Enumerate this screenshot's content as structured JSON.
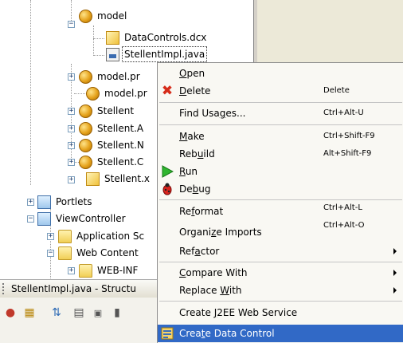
{
  "tree": {
    "nodes": [
      {
        "label": "model",
        "icon": "package-icon"
      },
      {
        "label": "DataControls.dcx",
        "icon": "dcx-file-icon"
      },
      {
        "label": "StellentImpl.java",
        "icon": "java-file-icon"
      },
      {
        "label": "model.pr",
        "icon": "package-icon"
      },
      {
        "label": "model.pr",
        "icon": "package-icon"
      },
      {
        "label": "Stellent",
        "icon": "package-icon"
      },
      {
        "label": "Stellent.A",
        "icon": "package-icon"
      },
      {
        "label": "Stellent.N",
        "icon": "package-icon"
      },
      {
        "label": "Stellent.C",
        "icon": "package-icon"
      },
      {
        "label": "Stellent.x",
        "icon": "dcx-file-icon"
      },
      {
        "label": "Portlets",
        "icon": "project-icon"
      },
      {
        "label": "ViewController",
        "icon": "project-icon"
      },
      {
        "label": "Application Sc",
        "icon": "folder-icon"
      },
      {
        "label": "Web Content",
        "icon": "folder-icon"
      },
      {
        "label": "WEB-INF",
        "icon": "folder-icon"
      }
    ],
    "expand_glyph": "+",
    "collapse_glyph": "−"
  },
  "structure": {
    "title": "StellentImpl.java - Structu"
  },
  "menu": {
    "items": [
      {
        "pre": "",
        "key": "O",
        "post": "pen",
        "shortcut": "",
        "icon": ""
      },
      {
        "pre": "",
        "key": "D",
        "post": "elete",
        "shortcut": "Delete",
        "icon": "delete-x-icon"
      },
      {
        "pre": "Find Usa",
        "key": "g",
        "post": "es...",
        "shortcut": "Ctrl+Alt-U",
        "icon": ""
      },
      {
        "pre": "",
        "key": "M",
        "post": "ake",
        "shortcut": "Ctrl+Shift-F9",
        "icon": ""
      },
      {
        "pre": "Reb",
        "key": "u",
        "post": "ild",
        "shortcut": "Alt+Shift-F9",
        "icon": ""
      },
      {
        "pre": "",
        "key": "R",
        "post": "un",
        "shortcut": "",
        "icon": "run-icon"
      },
      {
        "pre": "De",
        "key": "b",
        "post": "ug",
        "shortcut": "",
        "icon": "debug-bug-icon"
      },
      {
        "pre": "Re",
        "key": "f",
        "post": "ormat",
        "shortcut": "Ctrl+Alt-L",
        "icon": ""
      },
      {
        "pre": "Organi",
        "key": "z",
        "post": "e Imports",
        "shortcut": "Ctrl+Alt-O",
        "icon": ""
      },
      {
        "pre": "Ref",
        "key": "a",
        "post": "ctor",
        "shortcut": "",
        "icon": ""
      },
      {
        "pre": "",
        "key": "C",
        "post": "ompare With",
        "shortcut": "",
        "icon": ""
      },
      {
        "pre": "Replace ",
        "key": "W",
        "post": "ith",
        "shortcut": "",
        "icon": ""
      },
      {
        "pre": "Create ",
        "key": "J",
        "post": "2EE Web Service",
        "shortcut": "",
        "icon": ""
      },
      {
        "pre": "Crea",
        "key": "t",
        "post": "e Data Control",
        "shortcut": "",
        "icon": "data-control-icon"
      }
    ],
    "highlight_color": "#3169c6"
  }
}
